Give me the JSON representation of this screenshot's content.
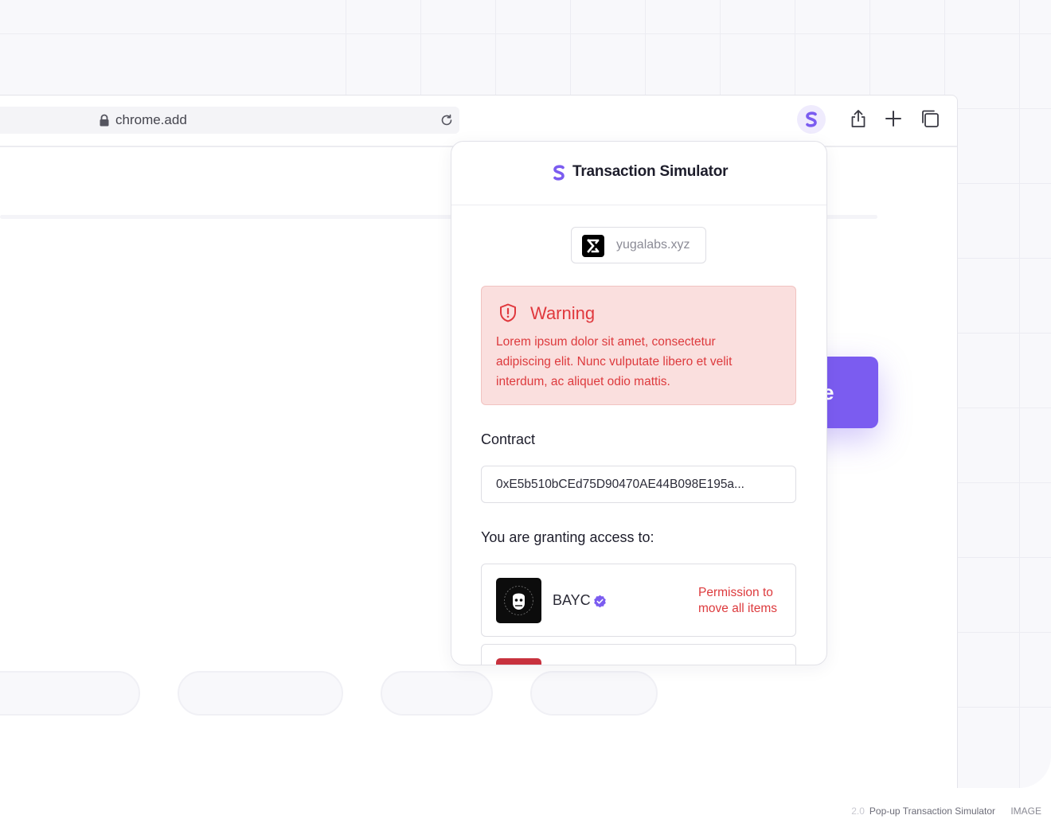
{
  "browser": {
    "url": "chrome.add",
    "icons": [
      "lock-icon",
      "reload-icon",
      "extension-icon",
      "share-icon",
      "plus-icon",
      "tabs-icon"
    ]
  },
  "background_button": {
    "label_fragment": "e"
  },
  "popup": {
    "title": "Transaction Simulator",
    "site": "yugalabs.xyz",
    "warning": {
      "title": "Warning",
      "body": "Lorem ipsum dolor sit amet, consectetur adipiscing elit. Nunc vulputate libero et velit interdum, ac aliquet odio mattis."
    },
    "contract_label": "Contract",
    "contract_address": "0xE5b510bCEd75D90470AE44B098E195a...",
    "access_label": "You are granting access to:",
    "items": [
      {
        "name": "BAYC",
        "verified": true,
        "permission_line1": "Permission to",
        "permission_line2": "move all items"
      }
    ]
  },
  "footer": {
    "number": "2.0",
    "caption": "Pop-up Transaction Simulator",
    "kind": "IMAGE"
  },
  "colors": {
    "accent": "#7b5cf0",
    "warning_bg": "#fadfde",
    "warning_text": "#dd3a3d"
  }
}
